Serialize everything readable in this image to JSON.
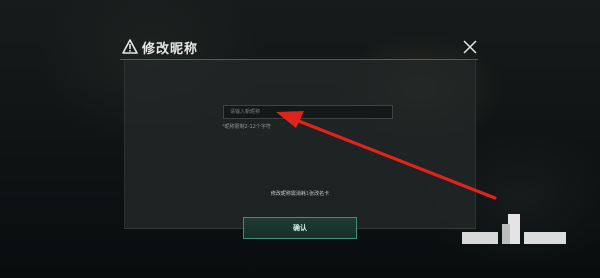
{
  "dialog": {
    "title": "修改昵称",
    "close_icon": "close-icon",
    "warning_icon": "warning-icon"
  },
  "form": {
    "nickname_placeholder": "请输入新昵称",
    "hint": "昵称限制2-12个字符",
    "hint_marker": "*",
    "cost_prefix": "修改昵称需消耗",
    "cost_amount": "1",
    "cost_suffix": "张改名卡",
    "confirm_label": "确认"
  },
  "annotation": {
    "arrow_color": "#e0241b",
    "type": "red-arrow-pointing-to-input"
  },
  "colors": {
    "accent": "#3f8f74",
    "title": "#e6e6e6",
    "required": "#d9534f"
  }
}
